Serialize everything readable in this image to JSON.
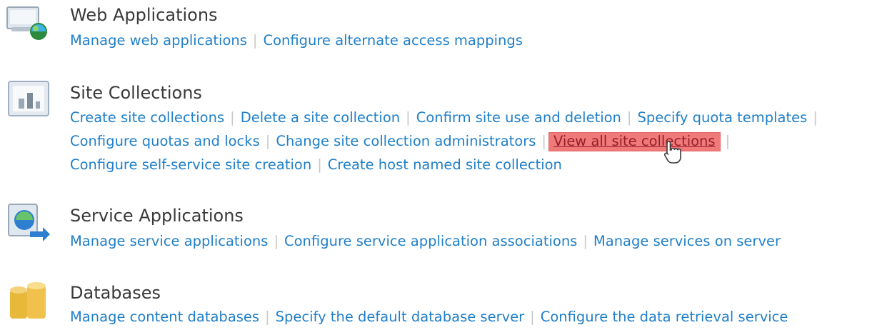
{
  "sections": [
    {
      "icon": "web-applications-icon",
      "title": "Web Applications",
      "lines": [
        [
          "Manage web applications",
          "Configure alternate access mappings"
        ]
      ]
    },
    {
      "icon": "site-collections-icon",
      "title": "Site Collections",
      "lines": [
        [
          "Create site collections",
          "Delete a site collection",
          "Confirm site use and deletion",
          "Specify quota templates"
        ],
        [
          "Configure quotas and locks",
          "Change site collection administrators",
          "View all site collections"
        ],
        [
          "Configure self-service site creation",
          "Create host named site collection"
        ]
      ]
    },
    {
      "icon": "service-applications-icon",
      "title": "Service Applications",
      "lines": [
        [
          "Manage service applications",
          "Configure service application associations",
          "Manage services on server"
        ]
      ]
    },
    {
      "icon": "databases-icon",
      "title": "Databases",
      "lines": [
        [
          "Manage content databases",
          "Specify the default database server",
          "Configure the data retrieval service"
        ]
      ]
    }
  ],
  "highlighted_link": "View all site collections",
  "colors": {
    "link": "#1f7fc8",
    "title": "#3a3a3a",
    "separator": "#c8c8c8",
    "highlight": "#ee7a7a"
  },
  "separator": "|"
}
